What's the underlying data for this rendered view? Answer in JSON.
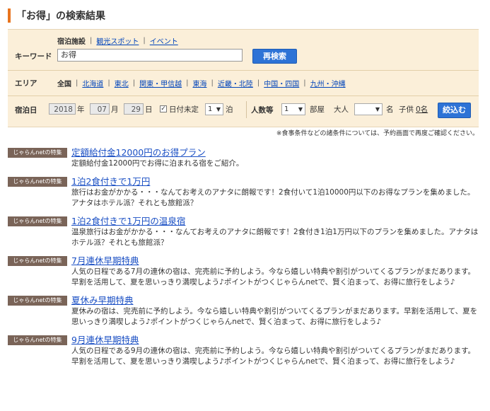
{
  "page_title": "「お得」の検索結果",
  "search": {
    "keyword_label": "キーワード",
    "tabs": [
      "宿泊施設",
      "観光スポット",
      "イベント"
    ],
    "keyword_value": "お得",
    "search_button": "再検索"
  },
  "area": {
    "label": "エリア",
    "items": [
      "全国",
      "北海道",
      "東北",
      "関東・甲信越",
      "東海",
      "近畿・北陸",
      "中国・四国",
      "九州・沖縄"
    ]
  },
  "stay": {
    "label": "宿泊日",
    "year": "2018",
    "year_unit": "年",
    "month": "07",
    "month_unit": "月",
    "day": "29",
    "day_unit": "日",
    "undecided_label": "日付未定",
    "nights": "1",
    "nights_unit": "泊",
    "people_label": "人数等",
    "rooms": "1",
    "rooms_unit": "部屋",
    "adult_label": "大人",
    "adult_value": "",
    "adult_unit": "名",
    "child_label": "子供",
    "child_value": "0名",
    "narrow_button": "絞込む"
  },
  "note": "※食事条件などの諸条件については、予約画面で再度ご確認ください。",
  "badge_text": "じゃらんnetの特集",
  "results": [
    {
      "title": "定額給付金12000円のお得プラン",
      "desc": "定額給付金12000円でお得に泊まれる宿をご紹介。"
    },
    {
      "title": "1泊2食付きで1万円",
      "desc": "旅行はお金がかかる・・・なんてお考えのアナタに朗報です！2食付いて1泊10000円以下のお得なプランを集めました。アナタはホテル派？それとも旅館派？"
    },
    {
      "title": "1泊2食付きで1万円の温泉宿",
      "desc": "温泉旅行はお金がかかる・・・なんてお考えのアナタに朗報です！2食付き1泊1万円以下のプランを集めました。アナタはホテル派？それとも旅館派？"
    },
    {
      "title": "7月連休早期特典",
      "desc": "人気の日程である7月の連休の宿は、完売前に予約しよう。今なら嬉しい特典や割引がついてくるプランがまだあります。早割を活用して、夏を思いっきり満喫しよう♪ポイントがつくじゃらんnetで、賢く泊まって、お得に旅行をしよう♪"
    },
    {
      "title": "夏休み早期特典",
      "desc": "夏休みの宿は、完売前に予約しよう。今なら嬉しい特典や割引がついてくるプランがまだあります。早割を活用して、夏を思いっきり満喫しよう♪ポイントがつくじゃらんnetで、賢く泊まって、お得に旅行をしよう♪"
    },
    {
      "title": "9月連休早期特典",
      "desc": "人気の日程である9月の連休の宿は、完売前に予約しよう。今なら嬉しい特典や割引がついてくるプランがまだあります。早割を活用して、夏を思いっきり満喫しよう♪ポイントがつくじゃらんnetで、賢く泊まって、お得に旅行をしよう♪"
    }
  ]
}
